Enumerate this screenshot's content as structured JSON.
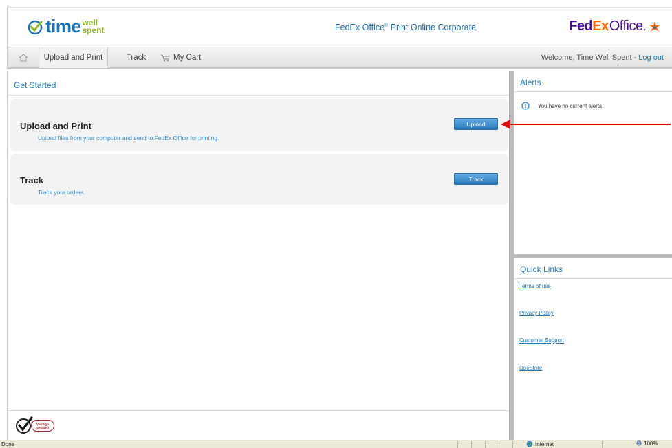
{
  "header": {
    "brand_main": "time",
    "brand_top": "well",
    "brand_bottom": "spent",
    "title": "FedEx Office",
    "title_sup": "®",
    "title_rest": " Print Online Corporate",
    "fedex_fed": "Fed",
    "fedex_ex": "Ex",
    "fedex_office": "Office",
    "fedex_dot": "."
  },
  "nav": {
    "home_icon": "home-icon",
    "upload_label": "Upload and Print",
    "track_label": "Track",
    "cart_label": "My Cart",
    "welcome_text": "Welcome, Time Well Spent - ",
    "logout_label": "Log out"
  },
  "main": {
    "heading": "Get Started",
    "cards": [
      {
        "title": "Upload and Print",
        "description": "Upload files from your computer and send to FedEx Office for printing.",
        "button": "Upload"
      },
      {
        "title": "Track",
        "description": "Track your orders.",
        "button": "Track"
      }
    ],
    "secured_badge": "VeriSign Secured"
  },
  "alerts": {
    "heading": "Alerts",
    "message": "You have no current alerts."
  },
  "quick_links": {
    "heading": "Quick Links",
    "items": [
      "Terms of use",
      "Privacy Policy",
      "Customer Support",
      "DocStore"
    ]
  },
  "status_bar": {
    "status": "Done",
    "zone": "Internet",
    "zoom": "100%"
  },
  "colors": {
    "accent_blue": "#2a7fc1",
    "fedex_purple": "#4d148c",
    "fedex_orange": "#ff6600",
    "brand_green": "#8dbb2e",
    "annotation_red": "#e01010"
  }
}
